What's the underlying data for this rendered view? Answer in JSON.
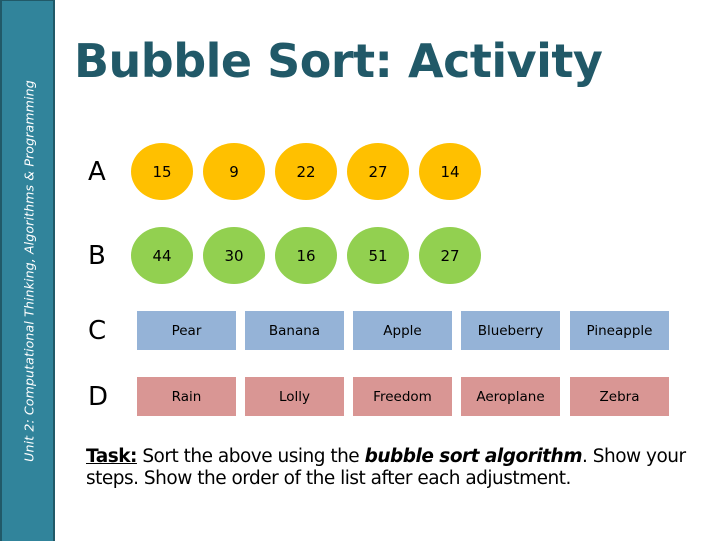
{
  "sidebar": {
    "text": "Unit 2: Computational Thinking, Algorithms & Programming",
    "color": "#31849b"
  },
  "title": "Bubble Sort: Activity",
  "rows": [
    {
      "label": "A",
      "shape": "circle",
      "color": "#ffc000",
      "items": [
        "15",
        "9",
        "22",
        "27",
        "14"
      ]
    },
    {
      "label": "B",
      "shape": "circle",
      "color": "#92d050",
      "items": [
        "44",
        "30",
        "16",
        "51",
        "27"
      ]
    },
    {
      "label": "C",
      "shape": "rectangle",
      "color": "#95b3d7",
      "items": [
        "Pear",
        "Banana",
        "Apple",
        "Blueberry",
        "Pineapple"
      ]
    },
    {
      "label": "D",
      "shape": "rectangle",
      "color": "#d99694",
      "items": [
        "Rain",
        "Lolly",
        "Freedom",
        "Aeroplane",
        "Zebra"
      ]
    }
  ],
  "task": {
    "lead": "Task:",
    "text1": " Sort the above using the ",
    "emphasis": "bubble sort algorithm",
    "text2": ". Show your steps. Show the order of the list after each adjustment."
  }
}
